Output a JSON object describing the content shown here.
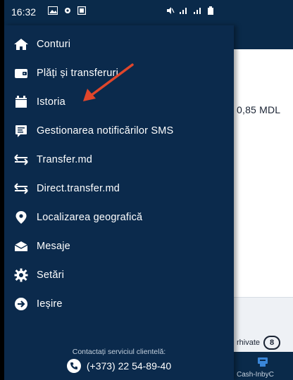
{
  "status_bar": {
    "time": "16:32"
  },
  "drawer": {
    "items": [
      {
        "label": "Conturi",
        "icon": "home-icon"
      },
      {
        "label": "Plăți și transferuri",
        "icon": "wallet-icon"
      },
      {
        "label": "Istoria",
        "icon": "calendar-icon"
      },
      {
        "label": "Gestionarea notificărilor SMS",
        "icon": "sms-icon"
      },
      {
        "label": "Transfer.md",
        "icon": "transfer-icon"
      },
      {
        "label": "Direct.transfer.md",
        "icon": "direct-transfer-icon"
      },
      {
        "label": "Localizarea geografică",
        "icon": "location-icon"
      },
      {
        "label": "Mesaje",
        "icon": "mail-icon"
      },
      {
        "label": "Setări",
        "icon": "gear-icon"
      },
      {
        "label": "Ieșire",
        "icon": "exit-icon"
      }
    ],
    "contact": {
      "title": "Contactați serviciul clientelă:",
      "phone": "(+373) 22 54-89-40"
    }
  },
  "background": {
    "amount": "0,85 MDL",
    "archived_label": "rhivate",
    "archived_count": "8",
    "bottom_tab_label": "Cash-InbyC"
  },
  "colors": {
    "drawer_bg": "#0b2a4c",
    "arrow": "#e0462b"
  }
}
